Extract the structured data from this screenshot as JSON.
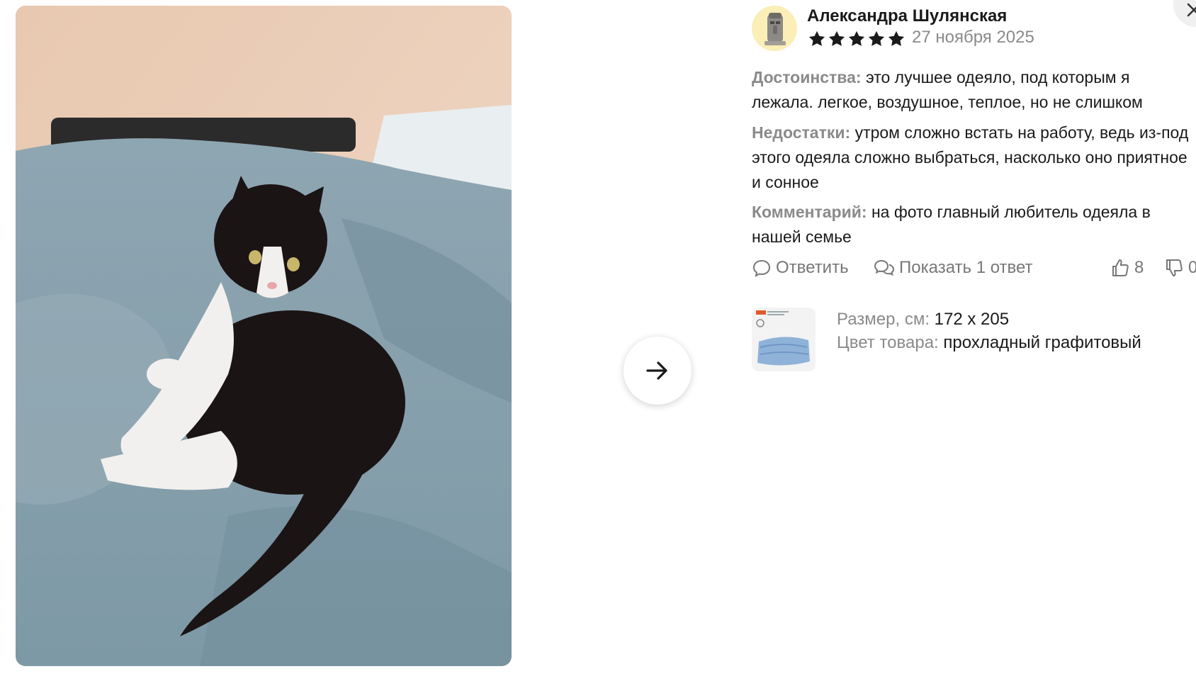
{
  "review": {
    "author": "Александра Шулянская",
    "rating": 5,
    "date": "27 ноября 2025",
    "pros_label": "Достоинства:",
    "pros_text": "это лучшее одеяло, под которым я лежала. легкое, воздушное, теплое, но не слишком",
    "cons_label": "Недостатки:",
    "cons_text": "утром сложно встать на работу, ведь из-под этого одеяла сложно выбраться, насколько оно приятное и сонное",
    "comment_label": "Комментарий:",
    "comment_text": "на фото главный любитель одеяла в нашей семье"
  },
  "actions": {
    "reply": "Ответить",
    "show_replies": "Показать 1 ответ",
    "likes": "8",
    "dislikes": "0"
  },
  "product": {
    "size_label": "Размер, см:",
    "size_value": "172 х 205",
    "color_label": "Цвет товара:",
    "color_value": "прохладный графитовый"
  },
  "colors": {
    "star": "#1a1a1a",
    "muted": "#8a8a8a",
    "avatar_bg": "#fbeeb6"
  },
  "icons": [
    "star-icon",
    "comment-icon",
    "comments-icon",
    "thumb-up-icon",
    "thumb-down-icon",
    "arrow-right-icon",
    "close-icon"
  ]
}
